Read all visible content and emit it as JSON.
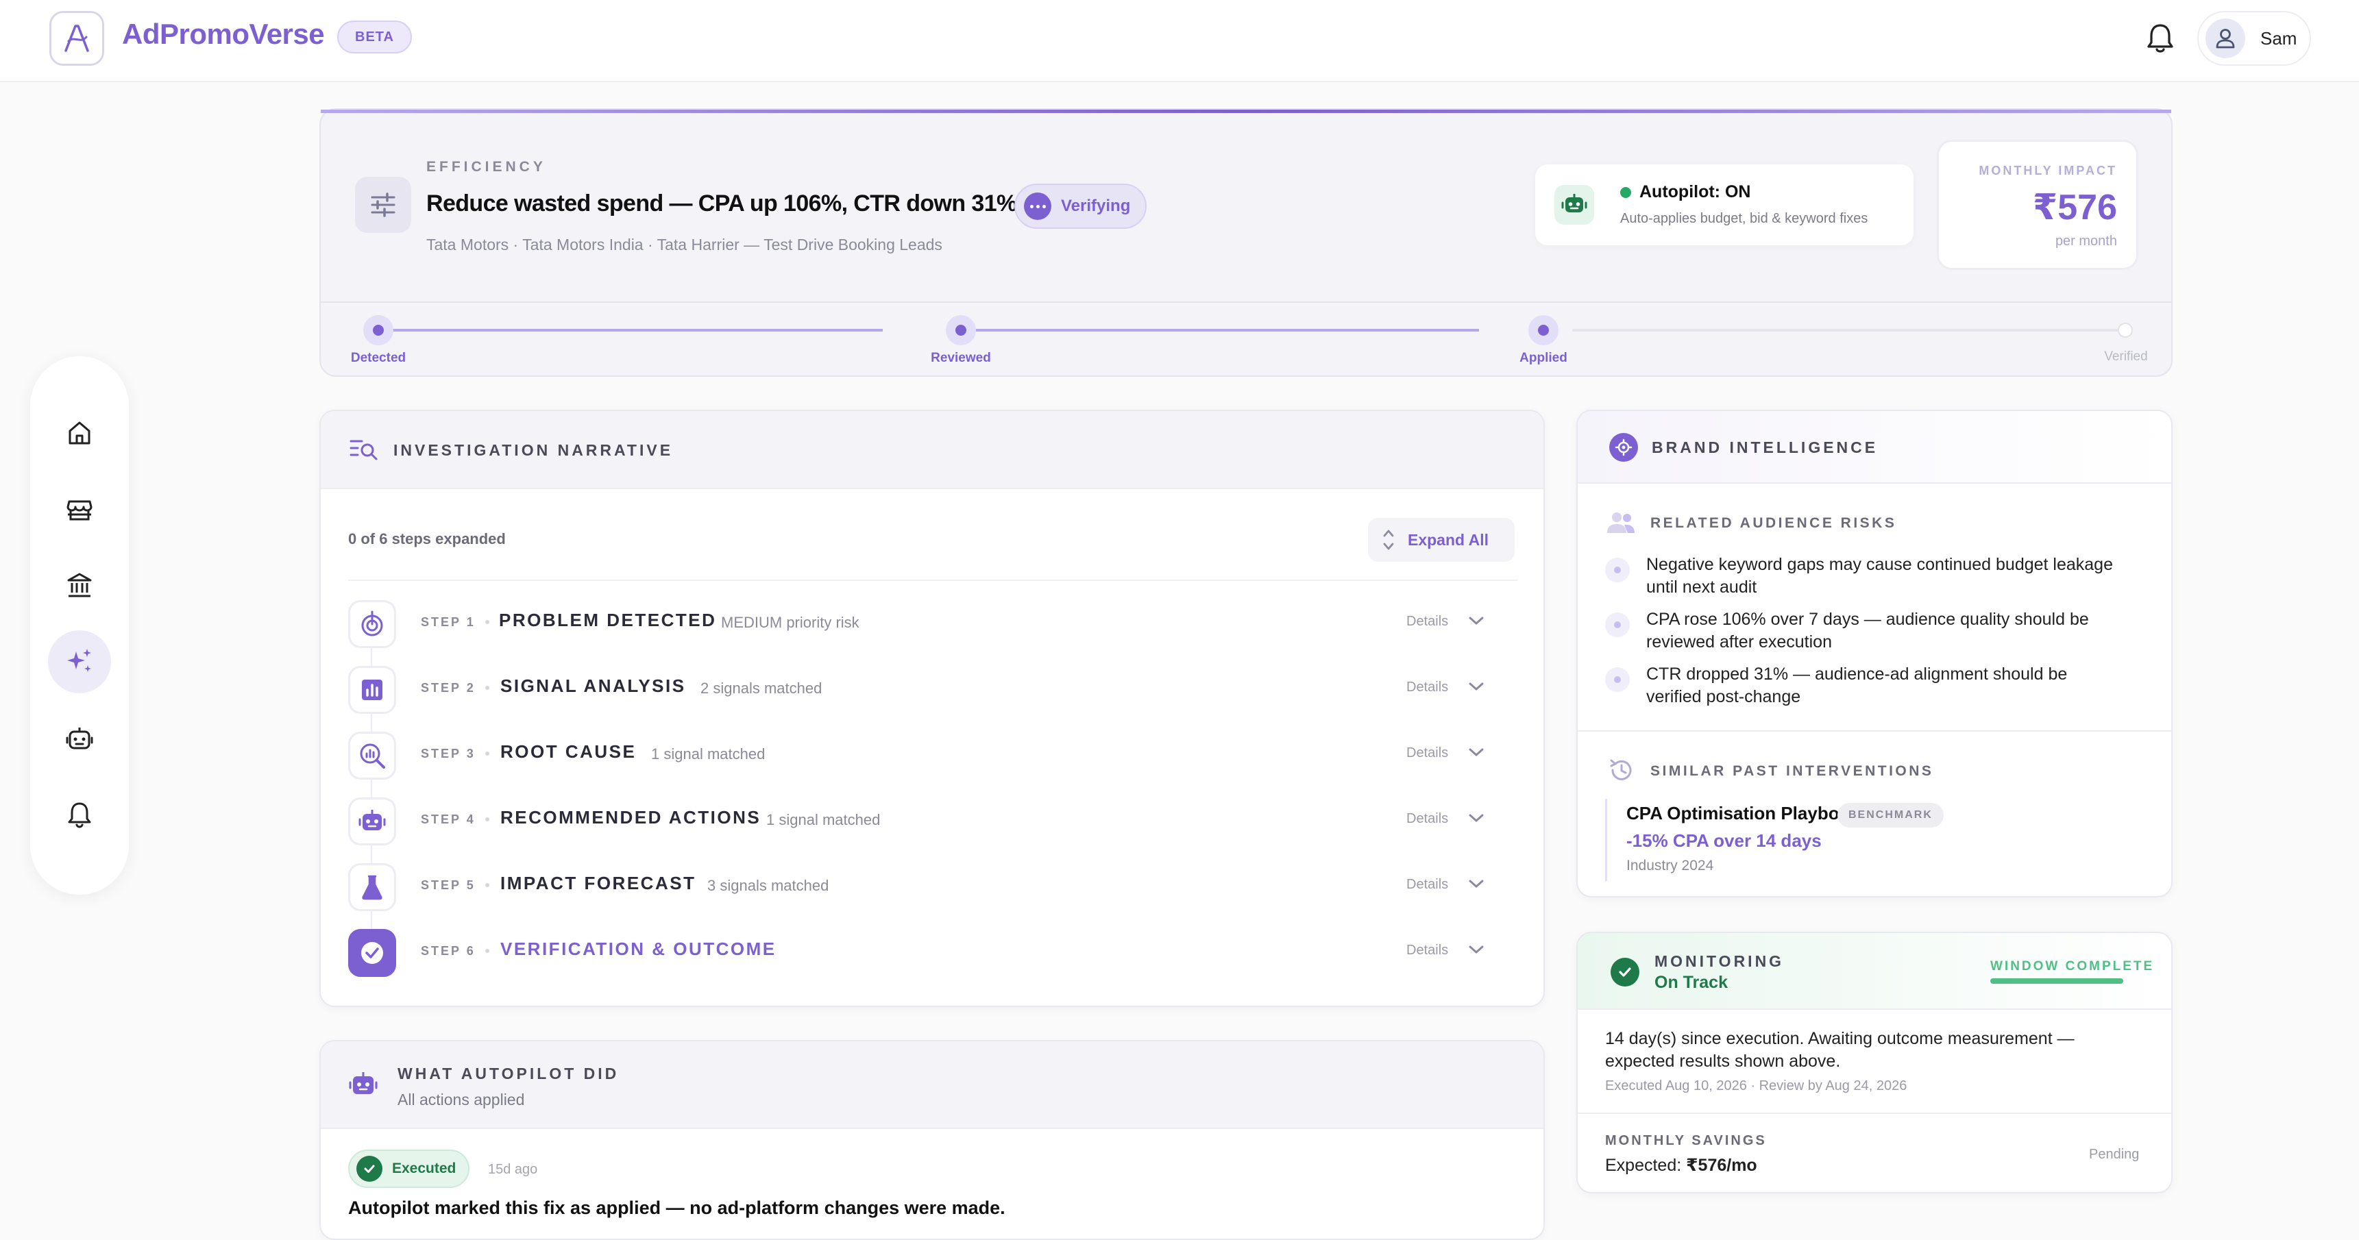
{
  "header": {
    "app_name": "AdPromoVerse",
    "beta_label": "BETA",
    "user_name": "Sam"
  },
  "sidebar": {
    "items": [
      {
        "name": "home",
        "icon": "home-icon"
      },
      {
        "name": "store",
        "icon": "store-icon"
      },
      {
        "name": "bank",
        "icon": "bank-icon"
      },
      {
        "name": "ai-insights",
        "icon": "sparkles-icon",
        "active": true
      },
      {
        "name": "autopilot",
        "icon": "robot-icon"
      },
      {
        "name": "notifications",
        "icon": "bell-icon"
      }
    ]
  },
  "issue": {
    "category": "EFFICIENCY",
    "headline": "Reduce wasted spend — CPA up 106%, CTR down 31%",
    "status": "Verifying",
    "breadcrumb": "Tata Motors · Tata Motors India · Tata Harrier — Test Drive Booking Leads",
    "autopilot_title": "Autopilot: ON",
    "autopilot_sub": "Auto-applies budget, bid & keyword fixes",
    "impact_label": "MONTHLY IMPACT",
    "impact_value": "₹576",
    "impact_sub": "per month",
    "progress": [
      {
        "label": "Detected",
        "done": true
      },
      {
        "label": "Reviewed",
        "done": true
      },
      {
        "label": "Applied",
        "done": true
      },
      {
        "label": "Verified",
        "done": false
      }
    ]
  },
  "investigation": {
    "title": "INVESTIGATION NARRATIVE",
    "steps_expanded": "0 of 6 steps expanded",
    "expand_all": "Expand All",
    "details_label": "Details",
    "steps": [
      {
        "num": "STEP 1",
        "name": "PROBLEM DETECTED",
        "meta": "MEDIUM priority risk"
      },
      {
        "num": "STEP 2",
        "name": "SIGNAL ANALYSIS",
        "meta": "2 signals matched"
      },
      {
        "num": "STEP 3",
        "name": "ROOT CAUSE",
        "meta": "1 signal matched"
      },
      {
        "num": "STEP 4",
        "name": "RECOMMENDED ACTIONS",
        "meta": "1 signal matched"
      },
      {
        "num": "STEP 5",
        "name": "IMPACT FORECAST",
        "meta": "3 signals matched"
      },
      {
        "num": "STEP 6",
        "name": "VERIFICATION & OUTCOME",
        "meta": ""
      }
    ]
  },
  "autopilot_did": {
    "title": "WHAT AUTOPILOT DID",
    "subtitle": "All actions applied",
    "badge": "Executed",
    "ago": "15d ago",
    "message": "Autopilot marked this fix as applied — no ad-platform changes were made."
  },
  "brand_intel": {
    "title": "BRAND INTELLIGENCE",
    "risks_title": "RELATED AUDIENCE RISKS",
    "risks": [
      "Negative keyword gaps may cause continued budget leakage until next audit",
      "CPA rose 106% over 7 days — audience quality should be reviewed after execution",
      "CTR dropped 31% — audience-ad alignment should be verified post-change"
    ],
    "past_title": "SIMILAR PAST INTERVENTIONS",
    "playbook_title": "CPA Optimisation Playbook",
    "playbook_badge": "BENCHMARK",
    "playbook_value": "-15% CPA over 14 days",
    "playbook_source": "Industry 2024"
  },
  "monitoring": {
    "title": "MONITORING",
    "status": "On Track",
    "window_label": "WINDOW COMPLETE",
    "window_progress": 1.0,
    "text": "14 day(s) since execution. Awaiting outcome measurement — expected results shown above.",
    "dates": "Executed Aug 10, 2026 · Review by Aug 24, 2026",
    "savings_label": "MONTHLY SAVINGS",
    "expected_label": "Expected:",
    "expected_value": "₹576/mo",
    "pending": "Pending"
  },
  "colors": {
    "accent": "#7c5fd1",
    "success": "#1f7a4a",
    "success_light": "#4fbf85"
  }
}
